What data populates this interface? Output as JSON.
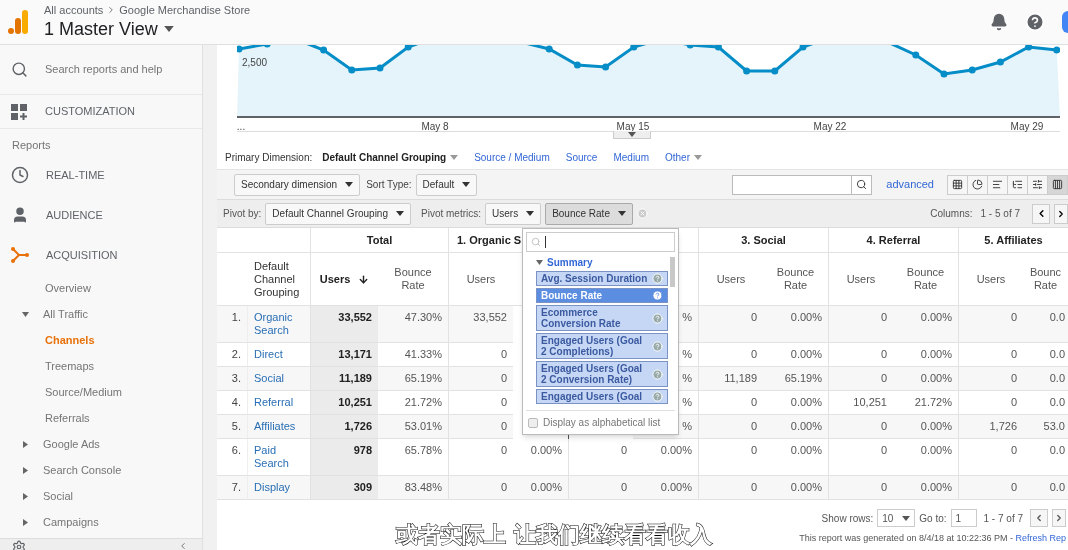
{
  "header": {
    "breadcrumb": [
      "All accounts",
      "Google Merchandise Store"
    ],
    "view_title": "1 Master View"
  },
  "sidebar": {
    "search_placeholder": "Search reports and help",
    "customization": "CUSTOMIZATION",
    "reports_heading": "Reports",
    "sections": [
      {
        "label": "REAL-TIME",
        "expanded": false
      },
      {
        "label": "AUDIENCE",
        "expanded": false
      },
      {
        "label": "ACQUISITION",
        "expanded": true,
        "children": [
          {
            "kind": "leaf",
            "label": "Overview",
            "selected": false
          },
          {
            "kind": "folder",
            "label": "All Traffic",
            "expanded": true,
            "children": [
              {
                "kind": "leaf",
                "label": "Channels",
                "selected": true
              },
              {
                "kind": "leaf",
                "label": "Treemaps",
                "selected": false
              },
              {
                "kind": "leaf",
                "label": "Source/Medium",
                "selected": false
              },
              {
                "kind": "leaf",
                "label": "Referrals",
                "selected": false
              }
            ]
          },
          {
            "kind": "folder",
            "label": "Google Ads",
            "expanded": false
          },
          {
            "kind": "folder",
            "label": "Search Console",
            "expanded": false
          },
          {
            "kind": "folder",
            "label": "Social",
            "expanded": false
          },
          {
            "kind": "folder",
            "label": "Campaigns",
            "expanded": false
          }
        ]
      }
    ]
  },
  "chart": {
    "y_label": "2,500",
    "x_labels": [
      "...",
      "May 8",
      "May 15",
      "May 22",
      "May 29"
    ]
  },
  "primary_dimension": {
    "label": "Primary Dimension:",
    "options": [
      {
        "kind": "option",
        "label": "Default Channel Grouping",
        "selected": true
      },
      {
        "kind": "option",
        "label": "Source / Medium",
        "selected": false
      },
      {
        "kind": "option",
        "label": "Source",
        "selected": false
      },
      {
        "kind": "option",
        "label": "Medium",
        "selected": false
      },
      {
        "kind": "menu",
        "label": "Other",
        "selected": false
      }
    ]
  },
  "toolbar": {
    "secondary_dimension": "Secondary dimension",
    "sort_label": "Sort Type:",
    "sort_value": "Default",
    "advanced_link": "advanced",
    "views": [
      {
        "selected": false
      },
      {
        "selected": false
      },
      {
        "selected": false
      },
      {
        "selected": false
      },
      {
        "selected": false
      },
      {
        "selected": true
      }
    ]
  },
  "pivot": {
    "label": "Pivot by:",
    "value": "Default Channel Grouping",
    "metrics_label": "Pivot metrics:",
    "metrics": [
      {
        "label": "Users",
        "open": false
      },
      {
        "label": "Bounce Rate",
        "open": true
      }
    ],
    "columns_label": "Columns:",
    "columns_range": "1 - 5 of 7"
  },
  "metric_menu": {
    "group": {
      "label": "Summary",
      "expanded": true
    },
    "items": [
      {
        "label": "Avg. Session Duration",
        "selected": false
      },
      {
        "label": "Bounce Rate",
        "selected": true
      },
      {
        "label": "Ecommerce Conversion Rate",
        "selected": false
      },
      {
        "label": "Engaged Users (Goal 2 Completions)",
        "selected": false
      },
      {
        "label": "Engaged Users (Goal 2 Conversion Rate)",
        "selected": false
      },
      {
        "label": "Engaged Users (Goal",
        "selected": false
      }
    ],
    "alphabetical": {
      "label": "Display as alphabetical list",
      "checked": false
    }
  },
  "table": {
    "dimension_header": "Default Channel Grouping",
    "groups": [
      {
        "kind": "title",
        "title": "Total",
        "columns": [
          {
            "label": "Users",
            "sorted": true
          },
          {
            "label": "Bounce Rate",
            "sorted": false
          }
        ]
      },
      {
        "kind": "title",
        "title": "1. Organic S",
        "columns": [
          {
            "label": "Users",
            "sorted": false
          }
        ]
      },
      {
        "kind": "covered"
      },
      {
        "kind": "title",
        "title": "3. Social",
        "columns": [
          {
            "label": "Users",
            "sorted": false
          },
          {
            "label": "Bounce Rate",
            "sorted": false
          }
        ]
      },
      {
        "kind": "title",
        "title": "4. Referral",
        "columns": [
          {
            "label": "Users",
            "sorted": false
          },
          {
            "label": "Bounce Rate",
            "sorted": false
          }
        ]
      },
      {
        "kind": "title",
        "title": "5. Affiliates",
        "columns": [
          {
            "label": "Users",
            "sorted": false
          },
          {
            "label": "Bounc Rate",
            "sorted": false
          }
        ]
      }
    ],
    "rows": [
      {
        "num": "1.",
        "channel": "Organic Search",
        "cells": [
          "33,552",
          "47.30%",
          "33,552",
          null,
          null,
          "%",
          "0",
          "0.00%",
          "0",
          "0.00%",
          "0",
          "0.0"
        ]
      },
      {
        "num": "2.",
        "channel": "Direct",
        "cells": [
          "13,171",
          "41.33%",
          "0",
          null,
          null,
          "%",
          "0",
          "0.00%",
          "0",
          "0.00%",
          "0",
          "0.0"
        ]
      },
      {
        "num": "3.",
        "channel": "Social",
        "cells": [
          "11,189",
          "65.19%",
          "0",
          null,
          null,
          "%",
          "11,189",
          "65.19%",
          "0",
          "0.00%",
          "0",
          "0.0"
        ]
      },
      {
        "num": "4.",
        "channel": "Referral",
        "cells": [
          "10,251",
          "21.72%",
          "0",
          null,
          null,
          "%",
          "0",
          "0.00%",
          "10,251",
          "21.72%",
          "0",
          "0.0"
        ]
      },
      {
        "num": "5.",
        "channel": "Affiliates",
        "cells": [
          "1,726",
          "53.01%",
          "0",
          null,
          null,
          "%",
          "0",
          "0.00%",
          "0",
          "0.00%",
          "1,726",
          "53.0"
        ]
      },
      {
        "num": "6.",
        "channel": "Paid Search",
        "cells": [
          "978",
          "65.78%",
          "0",
          "0.00%",
          "0",
          "0.00%",
          "0",
          "0.00%",
          "0",
          "0.00%",
          "0",
          "0.0"
        ]
      },
      {
        "num": "7.",
        "channel": "Display",
        "cells": [
          "309",
          "83.48%",
          "0",
          "0.00%",
          "0",
          "0.00%",
          "0",
          "0.00%",
          "0",
          "0.00%",
          "0",
          "0.0"
        ]
      }
    ]
  },
  "footer": {
    "show_rows_label": "Show rows:",
    "show_rows_value": "10",
    "goto_label": "Go to:",
    "goto_value": "1",
    "range": "1 - 7 of 7",
    "generated_text": "This report was generated on 8/4/18 at 10:22:36 PM - ",
    "refresh_link": "Refresh Rep"
  },
  "subtitle": "或者实际上 让我们继续看看收入"
}
